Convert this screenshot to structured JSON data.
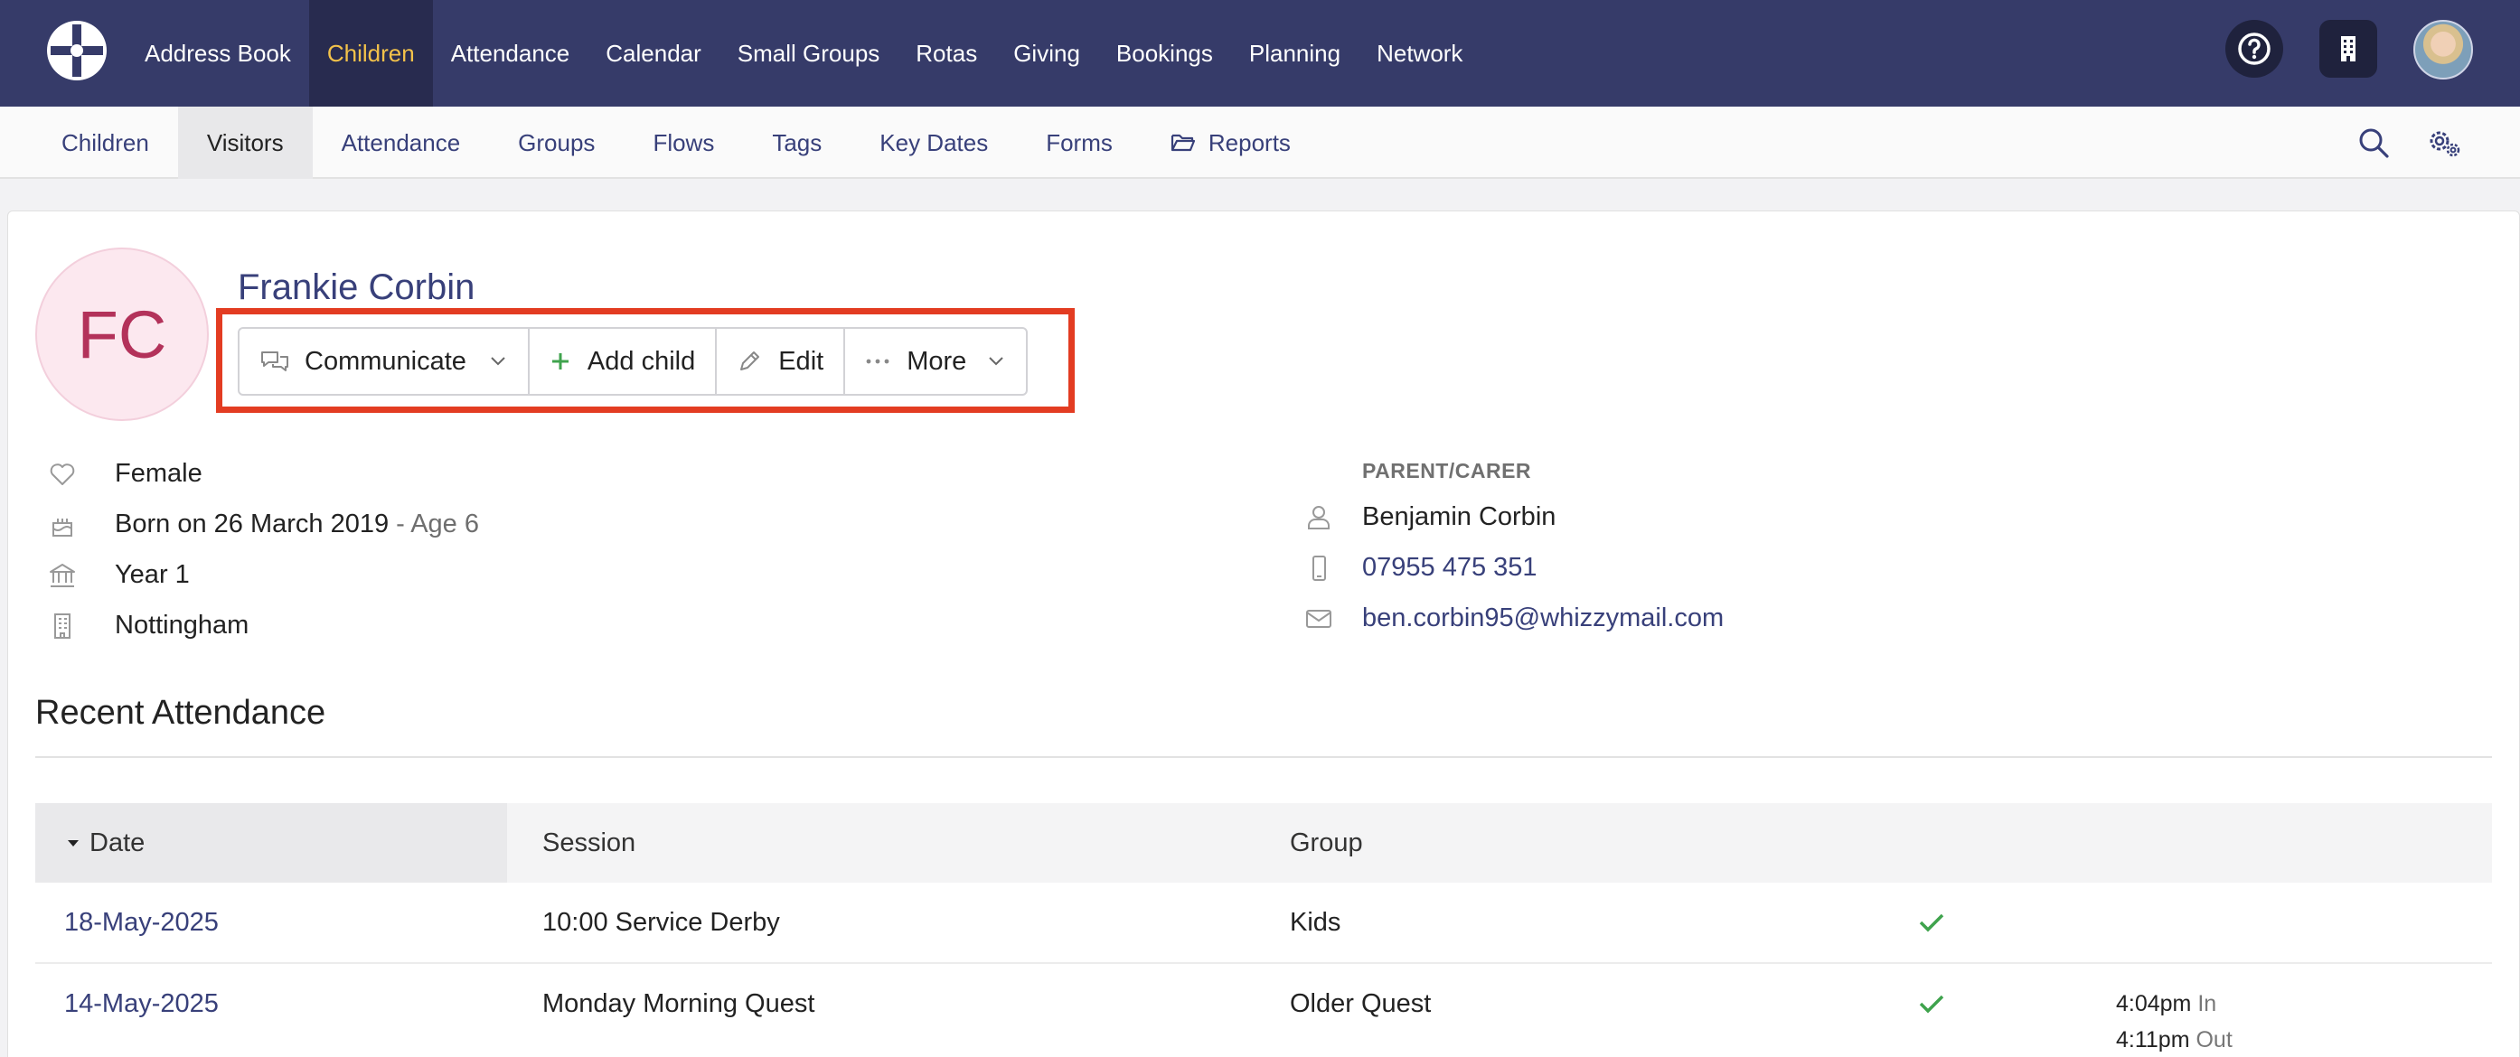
{
  "topnav": {
    "items": [
      {
        "label": "Address Book"
      },
      {
        "label": "Children",
        "active": true
      },
      {
        "label": "Attendance"
      },
      {
        "label": "Calendar"
      },
      {
        "label": "Small Groups"
      },
      {
        "label": "Rotas"
      },
      {
        "label": "Giving"
      },
      {
        "label": "Bookings"
      },
      {
        "label": "Planning"
      },
      {
        "label": "Network"
      }
    ],
    "icons": [
      "help-icon",
      "building-icon",
      "user-avatar"
    ]
  },
  "subnav": {
    "items": [
      {
        "label": "Children"
      },
      {
        "label": "Visitors",
        "active": true
      },
      {
        "label": "Attendance"
      },
      {
        "label": "Groups"
      },
      {
        "label": "Flows"
      },
      {
        "label": "Tags"
      },
      {
        "label": "Key Dates"
      },
      {
        "label": "Forms"
      },
      {
        "label": "Reports",
        "icon": "folder-open-icon"
      }
    ],
    "icons": [
      "search-icon",
      "settings-icon"
    ]
  },
  "person": {
    "initials": "FC",
    "name": "Frankie Corbin",
    "gender": "Female",
    "born": "Born on 26 March 2019",
    "age": "- Age 6",
    "school_year": "Year 1",
    "site": "Nottingham"
  },
  "actions": {
    "communicate": "Communicate",
    "add_child": "Add child",
    "edit": "Edit",
    "more": "More"
  },
  "parent": {
    "label": "PARENT/CARER",
    "name": "Benjamin Corbin",
    "phone": "07955 475 351",
    "email": "ben.corbin95@whizzymail.com"
  },
  "attendance": {
    "title": "Recent Attendance",
    "columns": {
      "date": "Date",
      "session": "Session",
      "group": "Group"
    },
    "rows": [
      {
        "date": "18-May-2025",
        "session": "10:00 Service Derby",
        "group": "Kids",
        "attended": true
      },
      {
        "date": "14-May-2025",
        "session": "Monday Morning Quest",
        "group": "Older Quest",
        "attended": true,
        "in_time": "4:04pm",
        "in_label": "In",
        "out_time": "4:11pm",
        "out_label": "Out"
      }
    ]
  },
  "colors": {
    "nav_bg": "#363b69",
    "active_nav": "#f3c24a",
    "link": "#38407a",
    "highlight": "#e33c22",
    "check": "#3fa34d",
    "avatar_text": "#b3325a"
  }
}
